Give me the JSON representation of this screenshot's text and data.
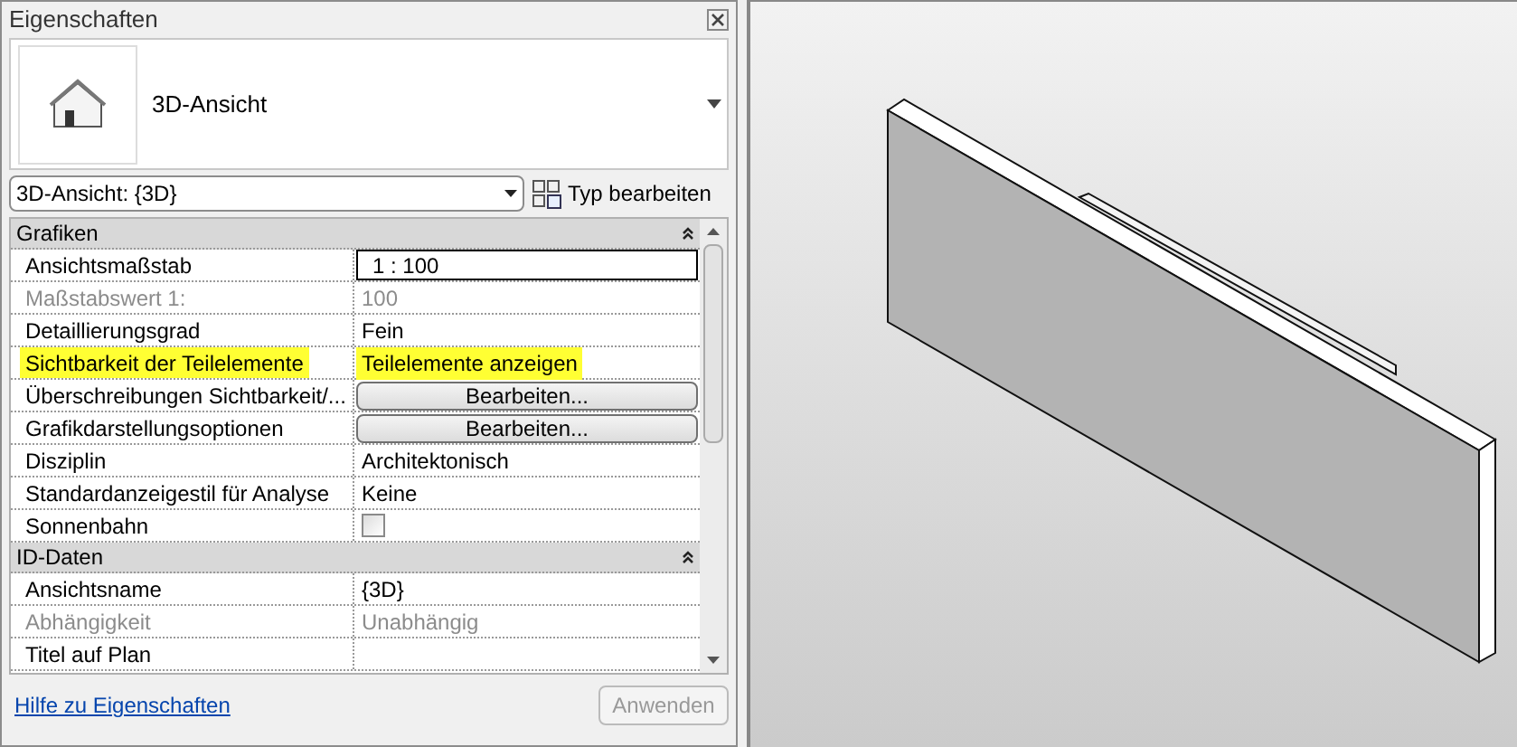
{
  "panel": {
    "title": "Eigenschaften",
    "type_name": "3D-Ansicht",
    "type_selector": "3D-Ansicht: {3D}",
    "edit_type_button": "Typ bearbeiten",
    "help_link": "Hilfe zu Eigenschaften",
    "apply_button": {
      "label": "Anwenden",
      "disabled": true
    }
  },
  "groups": [
    {
      "name": "Grafiken",
      "expanded": true,
      "rows": [
        {
          "label": "Ansichtsmaßstab",
          "kind": "input",
          "value": "1 : 100",
          "disabled": false,
          "highlighted": false
        },
        {
          "label": "Maßstabswert 1:",
          "kind": "text",
          "value": "100",
          "disabled": true,
          "highlighted": false
        },
        {
          "label": "Detaillierungsgrad",
          "kind": "text",
          "value": "Fein",
          "disabled": false,
          "highlighted": false
        },
        {
          "label": "Sichtbarkeit der Teilelemente",
          "kind": "text",
          "value": "Teilelemente anzeigen",
          "disabled": false,
          "highlighted": true
        },
        {
          "label": "Überschreibungen Sichtbarkeit/...",
          "kind": "button",
          "value": "Bearbeiten...",
          "disabled": false,
          "highlighted": false
        },
        {
          "label": "Grafikdarstellungsoptionen",
          "kind": "button",
          "value": "Bearbeiten...",
          "disabled": false,
          "highlighted": false
        },
        {
          "label": "Disziplin",
          "kind": "text",
          "value": "Architektonisch",
          "disabled": false,
          "highlighted": false
        },
        {
          "label": "Standardanzeigestil für Analyse",
          "kind": "text",
          "value": "Keine",
          "disabled": false,
          "highlighted": false
        },
        {
          "label": "Sonnenbahn",
          "kind": "checkbox",
          "checked": false,
          "disabled": false,
          "highlighted": false
        }
      ]
    },
    {
      "name": "ID-Daten",
      "expanded": true,
      "rows": [
        {
          "label": "Ansichtsname",
          "kind": "text",
          "value": "{3D}",
          "disabled": false,
          "highlighted": false
        },
        {
          "label": "Abhängigkeit",
          "kind": "text",
          "value": "Unabhängig",
          "disabled": true,
          "highlighted": false
        },
        {
          "label": "Titel auf Plan",
          "kind": "text",
          "disabled": false,
          "highlighted": false
        }
      ]
    }
  ]
}
